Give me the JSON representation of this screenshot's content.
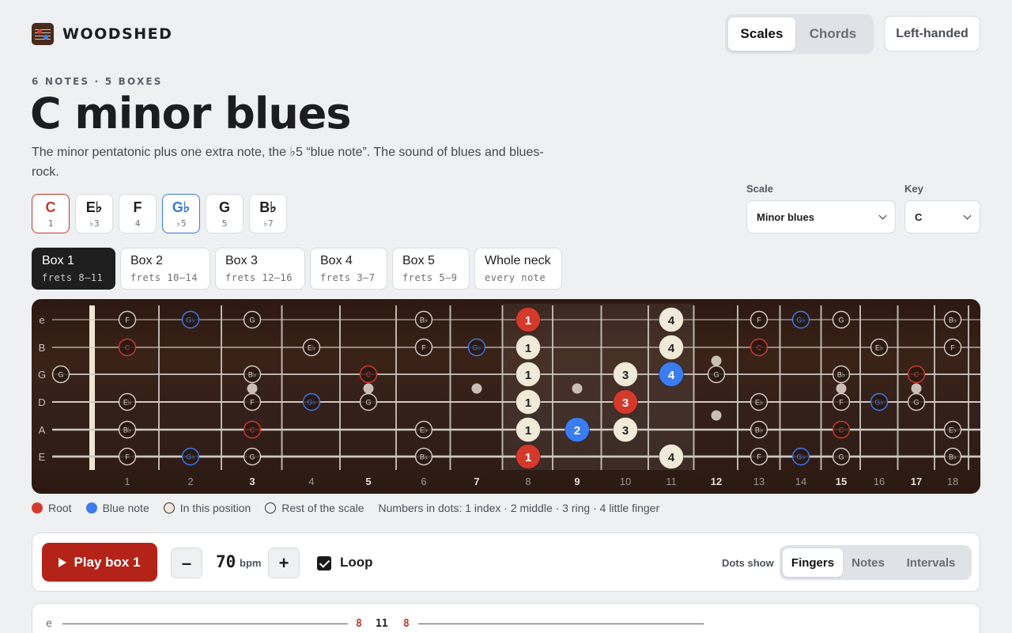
{
  "app": {
    "name": "WOODSHED",
    "logo_icon": "staff-logo-icon"
  },
  "mode_tabs": [
    {
      "label": "Scales",
      "active": true
    },
    {
      "label": "Chords",
      "active": false
    }
  ],
  "left_handed_label": "Left-handed",
  "eyebrow": "6 NOTES · 5 BOXES",
  "title": "C minor blues",
  "description": "The minor pentatonic plus one extra note, the ♭5 “blue note”. The sound of blues and blues-rock.",
  "notes": [
    {
      "name": "C",
      "degree": "1",
      "kind": "root"
    },
    {
      "name": "E♭",
      "degree": "♭3",
      "kind": "normal"
    },
    {
      "name": "F",
      "degree": "4",
      "kind": "normal"
    },
    {
      "name": "G♭",
      "degree": "♭5",
      "kind": "blue"
    },
    {
      "name": "G",
      "degree": "5",
      "kind": "normal"
    },
    {
      "name": "B♭",
      "degree": "♭7",
      "kind": "normal"
    }
  ],
  "scale_field": {
    "label": "Scale",
    "value": "Minor blues"
  },
  "key_field": {
    "label": "Key",
    "value": "C"
  },
  "boxes": [
    {
      "label": "Box 1",
      "sub": "frets 8–11",
      "active": true
    },
    {
      "label": "Box 2",
      "sub": "frets 10–14",
      "active": false
    },
    {
      "label": "Box 3",
      "sub": "frets 12–16",
      "active": false
    },
    {
      "label": "Box 4",
      "sub": "frets 3–7",
      "active": false
    },
    {
      "label": "Box 5",
      "sub": "frets 5–9",
      "active": false
    },
    {
      "label": "Whole neck",
      "sub": "every note",
      "active": false
    }
  ],
  "fretboard": {
    "strings": [
      "e",
      "B",
      "G",
      "D",
      "A",
      "E"
    ],
    "fret_numbers": [
      "1",
      "2",
      "3",
      "4",
      "5",
      "6",
      "7",
      "8",
      "9",
      "10",
      "11",
      "12",
      "13",
      "14",
      "15",
      "16",
      "17",
      "18"
    ],
    "bold_frets": [
      3,
      5,
      7,
      9,
      12,
      15,
      17
    ],
    "position_range": [
      8,
      11
    ],
    "colors": {
      "root": "#d33a2c",
      "blue": "#3b7cf0",
      "position": "#f1ead9",
      "rest_ring": "#d9cfc2"
    },
    "notes": [
      {
        "s": 0,
        "f": 1,
        "n": "F",
        "t": "rest"
      },
      {
        "s": 0,
        "f": 2,
        "n": "G♭",
        "t": "rest-blue"
      },
      {
        "s": 0,
        "f": 3,
        "n": "G",
        "t": "rest"
      },
      {
        "s": 0,
        "f": 6,
        "n": "B♭",
        "t": "rest"
      },
      {
        "s": 0,
        "f": 8,
        "n": "1",
        "t": "root"
      },
      {
        "s": 0,
        "f": 11,
        "n": "4",
        "t": "pos"
      },
      {
        "s": 0,
        "f": 13,
        "n": "F",
        "t": "rest"
      },
      {
        "s": 0,
        "f": 14,
        "n": "G♭",
        "t": "rest-blue"
      },
      {
        "s": 0,
        "f": 15,
        "n": "G",
        "t": "rest"
      },
      {
        "s": 0,
        "f": 18,
        "n": "B♭",
        "t": "rest"
      },
      {
        "s": 1,
        "f": 1,
        "n": "C",
        "t": "rest-root"
      },
      {
        "s": 1,
        "f": 4,
        "n": "E♭",
        "t": "rest"
      },
      {
        "s": 1,
        "f": 6,
        "n": "F",
        "t": "rest"
      },
      {
        "s": 1,
        "f": 7,
        "n": "G♭",
        "t": "rest-blue"
      },
      {
        "s": 1,
        "f": 8,
        "n": "1",
        "t": "pos"
      },
      {
        "s": 1,
        "f": 11,
        "n": "4",
        "t": "pos"
      },
      {
        "s": 1,
        "f": 13,
        "n": "C",
        "t": "rest-root"
      },
      {
        "s": 1,
        "f": 16,
        "n": "E♭",
        "t": "rest"
      },
      {
        "s": 1,
        "f": 18,
        "n": "F",
        "t": "rest"
      },
      {
        "s": 2,
        "f": 0,
        "n": "G",
        "t": "rest"
      },
      {
        "s": 2,
        "f": 3,
        "n": "B♭",
        "t": "rest"
      },
      {
        "s": 2,
        "f": 5,
        "n": "C",
        "t": "rest-root"
      },
      {
        "s": 2,
        "f": 8,
        "n": "1",
        "t": "pos"
      },
      {
        "s": 2,
        "f": 10,
        "n": "3",
        "t": "pos"
      },
      {
        "s": 2,
        "f": 11,
        "n": "4",
        "t": "blue"
      },
      {
        "s": 2,
        "f": 12,
        "n": "G",
        "t": "rest"
      },
      {
        "s": 2,
        "f": 15,
        "n": "B♭",
        "t": "rest"
      },
      {
        "s": 2,
        "f": 17,
        "n": "C",
        "t": "rest-root"
      },
      {
        "s": 3,
        "f": 1,
        "n": "E♭",
        "t": "rest"
      },
      {
        "s": 3,
        "f": 3,
        "n": "F",
        "t": "rest"
      },
      {
        "s": 3,
        "f": 4,
        "n": "G♭",
        "t": "rest-blue"
      },
      {
        "s": 3,
        "f": 5,
        "n": "G",
        "t": "rest"
      },
      {
        "s": 3,
        "f": 8,
        "n": "1",
        "t": "pos"
      },
      {
        "s": 3,
        "f": 10,
        "n": "3",
        "t": "root"
      },
      {
        "s": 3,
        "f": 13,
        "n": "E♭",
        "t": "rest"
      },
      {
        "s": 3,
        "f": 15,
        "n": "F",
        "t": "rest"
      },
      {
        "s": 3,
        "f": 16,
        "n": "G♭",
        "t": "rest-blue"
      },
      {
        "s": 3,
        "f": 17,
        "n": "G",
        "t": "rest"
      },
      {
        "s": 4,
        "f": 1,
        "n": "B♭",
        "t": "rest"
      },
      {
        "s": 4,
        "f": 3,
        "n": "C",
        "t": "rest-root"
      },
      {
        "s": 4,
        "f": 6,
        "n": "E♭",
        "t": "rest"
      },
      {
        "s": 4,
        "f": 8,
        "n": "1",
        "t": "pos"
      },
      {
        "s": 4,
        "f": 9,
        "n": "2",
        "t": "blue"
      },
      {
        "s": 4,
        "f": 10,
        "n": "3",
        "t": "pos"
      },
      {
        "s": 4,
        "f": 13,
        "n": "B♭",
        "t": "rest"
      },
      {
        "s": 4,
        "f": 15,
        "n": "C",
        "t": "rest-root"
      },
      {
        "s": 4,
        "f": 18,
        "n": "E♭",
        "t": "rest"
      },
      {
        "s": 5,
        "f": 1,
        "n": "F",
        "t": "rest"
      },
      {
        "s": 5,
        "f": 2,
        "n": "G♭",
        "t": "rest-blue"
      },
      {
        "s": 5,
        "f": 3,
        "n": "G",
        "t": "rest"
      },
      {
        "s": 5,
        "f": 6,
        "n": "B♭",
        "t": "rest"
      },
      {
        "s": 5,
        "f": 8,
        "n": "1",
        "t": "root"
      },
      {
        "s": 5,
        "f": 11,
        "n": "4",
        "t": "pos"
      },
      {
        "s": 5,
        "f": 13,
        "n": "F",
        "t": "rest"
      },
      {
        "s": 5,
        "f": 14,
        "n": "G♭",
        "t": "rest-blue"
      },
      {
        "s": 5,
        "f": 15,
        "n": "G",
        "t": "rest"
      },
      {
        "s": 5,
        "f": 18,
        "n": "B♭",
        "t": "rest"
      }
    ]
  },
  "legend": {
    "root": "Root",
    "blue": "Blue note",
    "position": "In this position",
    "rest": "Rest of the scale",
    "fingers_note": "Numbers in dots: 1 index · 2 middle · 3 ring · 4 little finger"
  },
  "controls": {
    "play_label": "Play box 1",
    "minus": "–",
    "plus": "+",
    "bpm_value": "70",
    "bpm_unit": "bpm",
    "loop_label": "Loop",
    "loop_checked": true,
    "dots_label": "Dots show",
    "dots_options": [
      {
        "label": "Fingers",
        "active": true
      },
      {
        "label": "Notes",
        "active": false
      },
      {
        "label": "Intervals",
        "active": false
      }
    ]
  },
  "tab": {
    "string": "e",
    "notes": [
      {
        "v": "8",
        "root": true
      },
      {
        "v": "11",
        "root": false
      },
      {
        "v": "8",
        "root": true
      }
    ]
  }
}
